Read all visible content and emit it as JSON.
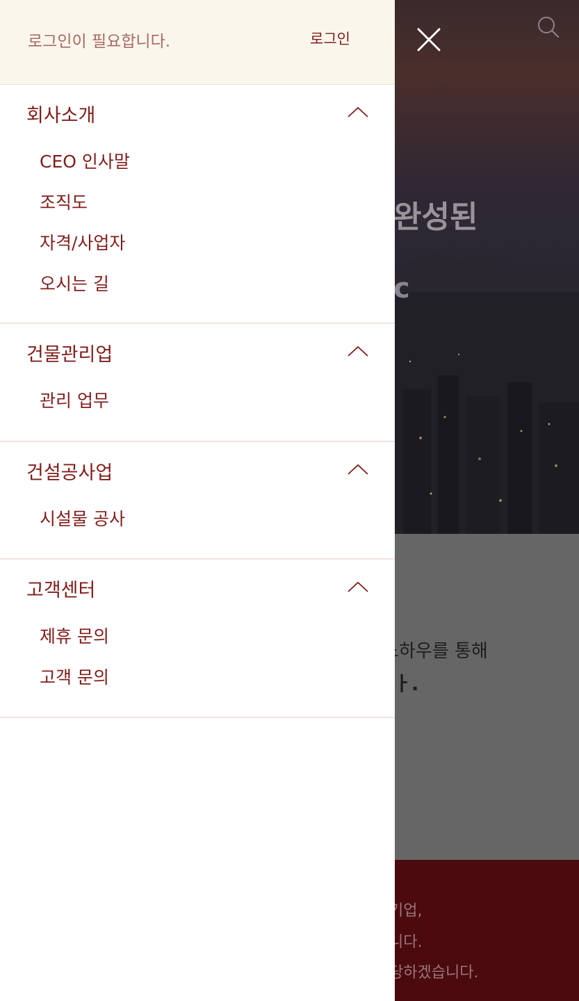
{
  "drawer": {
    "login_message": "로그인이 필요합니다.",
    "login_label": "로그인",
    "sections": [
      {
        "title": "회사소개",
        "expanded": true,
        "items": [
          "CEO 인사말",
          "조직도",
          "자격/사업자",
          "오시는 길"
        ]
      },
      {
        "title": "건물관리업",
        "expanded": true,
        "items": [
          "관리 업무"
        ]
      },
      {
        "title": "건설공사업",
        "expanded": true,
        "items": [
          "시설물 공사"
        ]
      },
      {
        "title": "고객센터",
        "expanded": true,
        "items": [
          "제휴 문의",
          "고객 문의"
        ]
      }
    ]
  },
  "background": {
    "hero_title_fragment": "완성된",
    "hero_subtitle_fragment": "c",
    "mid_text_1": "노하우를 통해",
    "mid_text_2": "ㅏ.",
    "footer_lines": [
      "기업,",
      "니다.",
      "당하겠습니다."
    ]
  },
  "icons": {
    "close": "close-icon",
    "search": "search-icon",
    "chevron": "chevron-up-icon"
  },
  "colors": {
    "accent": "#7f1d1a",
    "header_bg": "#fbf6ec",
    "footer_bg": "#4a0a0e"
  }
}
